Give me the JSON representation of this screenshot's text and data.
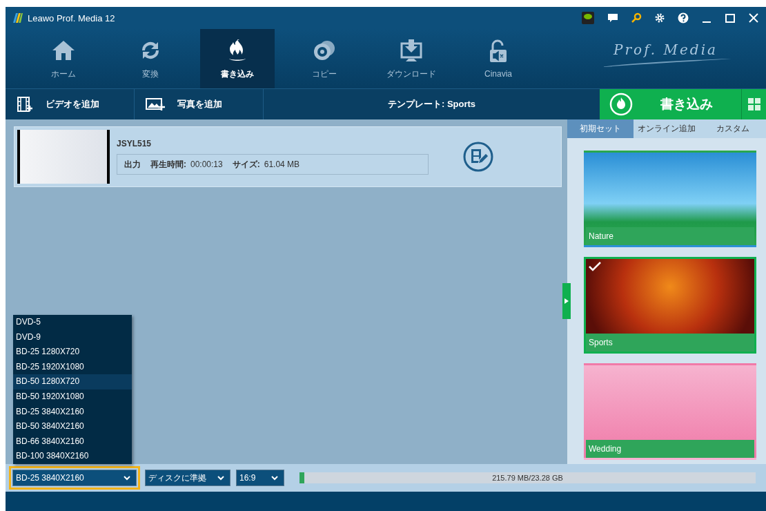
{
  "window": {
    "title": "Leawo Prof. Media 12",
    "brand": "Prof. Media"
  },
  "nav": [
    {
      "label": "ホーム",
      "kind": "home",
      "selected": false
    },
    {
      "label": "変換",
      "kind": "convert",
      "selected": false
    },
    {
      "label": "書き込み",
      "kind": "burn",
      "selected": true
    },
    {
      "label": "コピー",
      "kind": "copy",
      "selected": false
    },
    {
      "label": "ダウンロード",
      "kind": "download",
      "selected": false
    },
    {
      "label": "Cinavia",
      "kind": "cinavia",
      "selected": false
    }
  ],
  "toolbar": {
    "add_video": "ビデオを追加",
    "add_photo": "写真を追加",
    "template": "テンプレート: Sports",
    "burn_button": "書き込み"
  },
  "media": {
    "title": "JSYL515",
    "output": "出力",
    "duration_label": "再生時間:",
    "duration": "00:00:13",
    "size_label": "サイズ:",
    "size": "61.04 MB"
  },
  "template_tabs": [
    {
      "label": "初期セット",
      "selected": true
    },
    {
      "label": "オンライン追加",
      "selected": false
    },
    {
      "label": "カスタム",
      "selected": false
    }
  ],
  "templates": [
    {
      "name": "Nature",
      "kind": "nature",
      "selected": false
    },
    {
      "name": "Sports",
      "kind": "sports",
      "selected": true
    },
    {
      "name": "Wedding",
      "kind": "wedding",
      "selected": false
    }
  ],
  "disc_menu": [
    {
      "label": "DVD-5",
      "selected": false
    },
    {
      "label": "DVD-9",
      "selected": false
    },
    {
      "label": "BD-25 1280X720",
      "selected": false
    },
    {
      "label": "BD-25 1920X1080",
      "selected": false
    },
    {
      "label": "BD-50 1280X720",
      "selected": true
    },
    {
      "label": "BD-50 1920X1080",
      "selected": false
    },
    {
      "label": "BD-25 3840X2160",
      "selected": false
    },
    {
      "label": "BD-50 3840X2160",
      "selected": false
    },
    {
      "label": "BD-66 3840X2160",
      "selected": false
    },
    {
      "label": "BD-100 3840X2160",
      "selected": false
    }
  ],
  "bottom": {
    "disc_type": "BD-25 3840X2160",
    "quality": "ディスクに準拠",
    "aspect": "16:9",
    "usage": "215.79 MB/23.28 GB",
    "level": 0.01
  }
}
